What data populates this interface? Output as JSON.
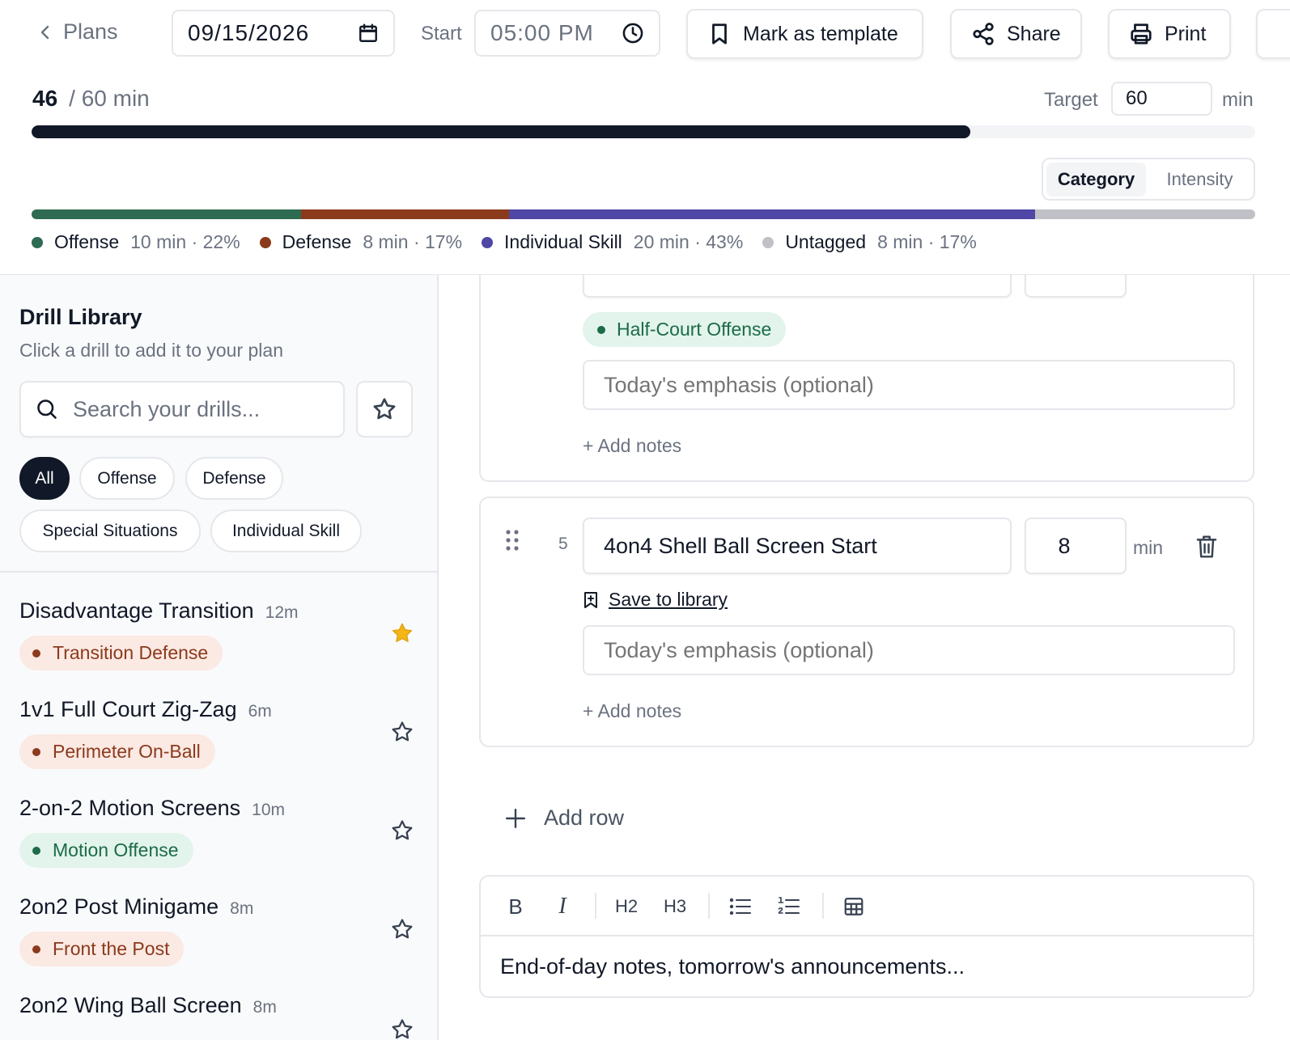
{
  "topbar": {
    "back_label": "Plans",
    "date": "09/15/2026",
    "start_label": "Start",
    "start_time": "05:00 PM",
    "mark_template_label": "Mark as template",
    "share_label": "Share",
    "print_label": "Print"
  },
  "summary": {
    "current_minutes": "46",
    "total_label": "/ 60 min",
    "progress": 0.767,
    "target_label": "Target",
    "target_value": "60",
    "target_unit": "min",
    "view_toggle": [
      "Category",
      "Intensity"
    ],
    "active_view": "Category"
  },
  "categories": [
    {
      "name": "Offense",
      "detail": "10 min · 22%",
      "share": 0.22,
      "color": "#2f6b52"
    },
    {
      "name": "Defense",
      "detail": "8 min · 17%",
      "share": 0.17,
      "color": "#8b3a1c"
    },
    {
      "name": "Individual Skill",
      "detail": "20 min · 43%",
      "share": 0.43,
      "color": "#4f46a5"
    },
    {
      "name": "Untagged",
      "detail": "8 min · 17%",
      "share": 0.18,
      "color": "#bfc1c6"
    }
  ],
  "sidebar": {
    "title": "Drill Library",
    "subtitle": "Click a drill to add it to your plan",
    "search_placeholder": "Search your drills...",
    "filters": [
      "All",
      "Offense",
      "Defense",
      "Special Situations",
      "Individual Skill"
    ],
    "active_filter": "All",
    "drills": [
      {
        "name": "Disadvantage Transition",
        "duration": "12m",
        "tag": "Transition Defense",
        "tag_color": "red",
        "favorite": true
      },
      {
        "name": "1v1 Full Court Zig-Zag",
        "duration": "6m",
        "tag": "Perimeter On-Ball",
        "tag_color": "red",
        "favorite": false
      },
      {
        "name": "2-on-2 Motion Screens",
        "duration": "10m",
        "tag": "Motion Offense",
        "tag_color": "green",
        "favorite": false
      },
      {
        "name": "2on2 Post Minigame",
        "duration": "8m",
        "tag": "Front the Post",
        "tag_color": "red",
        "favorite": false
      },
      {
        "name": "2on2 Wing Ball Screen",
        "duration": "8m",
        "tag": "",
        "tag_color": "",
        "favorite": false
      }
    ]
  },
  "plan": {
    "row4": {
      "tag": "Half-Court Offense",
      "emphasis_placeholder": "Today's emphasis (optional)",
      "add_notes": "+ Add notes"
    },
    "row5": {
      "number": "5",
      "name": "4on4 Shell Ball Screen Start",
      "minutes": "8",
      "min_label": "min",
      "save_to_library": "Save to library",
      "emphasis_placeholder": "Today's emphasis (optional)",
      "add_notes": "+ Add notes"
    },
    "add_row_label": "Add row"
  },
  "editor": {
    "toolbar": [
      "B",
      "I",
      "H2",
      "H3",
      "bulleted-list",
      "numbered-list",
      "table"
    ],
    "placeholder": "End-of-day notes, tomorrow's announcements..."
  }
}
